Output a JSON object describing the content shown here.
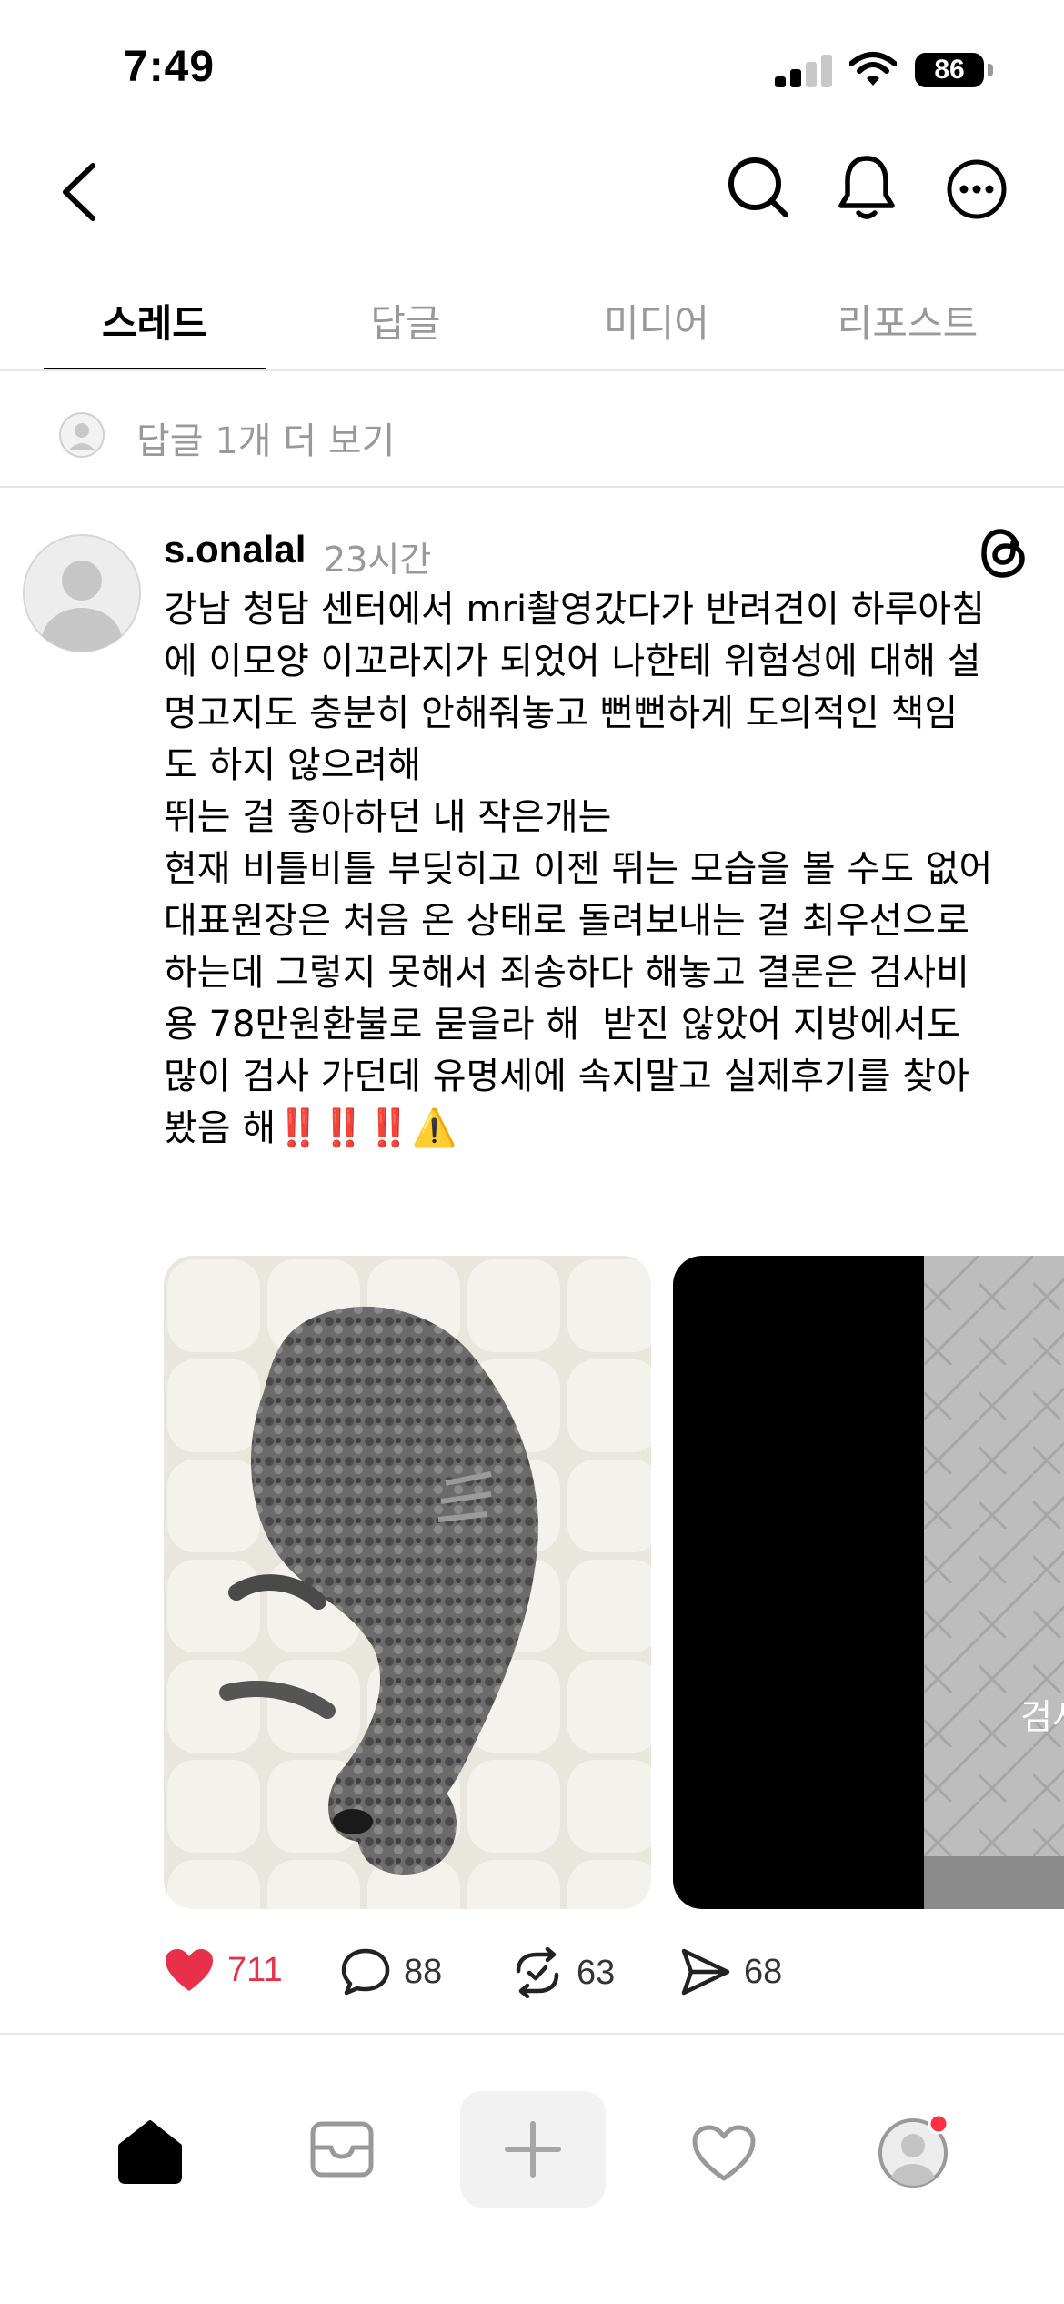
{
  "status_bar": {
    "time": "7:49",
    "battery": "86"
  },
  "tabs": [
    {
      "label": "스레드",
      "active": true
    },
    {
      "label": "답글",
      "active": false
    },
    {
      "label": "미디어",
      "active": false
    },
    {
      "label": "리포스트",
      "active": false
    }
  ],
  "more_replies": "답글 1개 더 보기",
  "post": {
    "username": "s.onalal",
    "time": "23시간",
    "body": "강남 청담 센터에서 mri촬영갔다가 반려견이 하루아침\n에 이모양 이꼬라지가 되었어 나한테 위험성에 대해 설\n명고지도 충분히 안해줘놓고 뻔뻔하게 도의적인 책임\n도 하지 않으려해\n뛰는 걸 좋아하던 내 작은개는\n현재 비틀비틀 부딪히고 이젠 뛰는 모습을 볼 수도 없어\n대표원장은 처음 온 상태로 돌려보내는 걸 최우선으로\n하는데 그렇지 못해서 죄송하다 해놓고 결론은 검사비\n용 78만원환불로 묻을라 해  받진 않았어 지방에서도\n많이 검사 가던데 유명세에 속지말고 실제후기를 찾아\n봤음 해‼️‼️‼️⚠️",
    "image2_caption": "검사",
    "actions": {
      "likes": "711",
      "comments": "88",
      "reposts": "63",
      "shares": "68"
    }
  },
  "colors": {
    "like": "#e8304a",
    "muted": "#999999",
    "notification_dot": "#ff3040"
  }
}
